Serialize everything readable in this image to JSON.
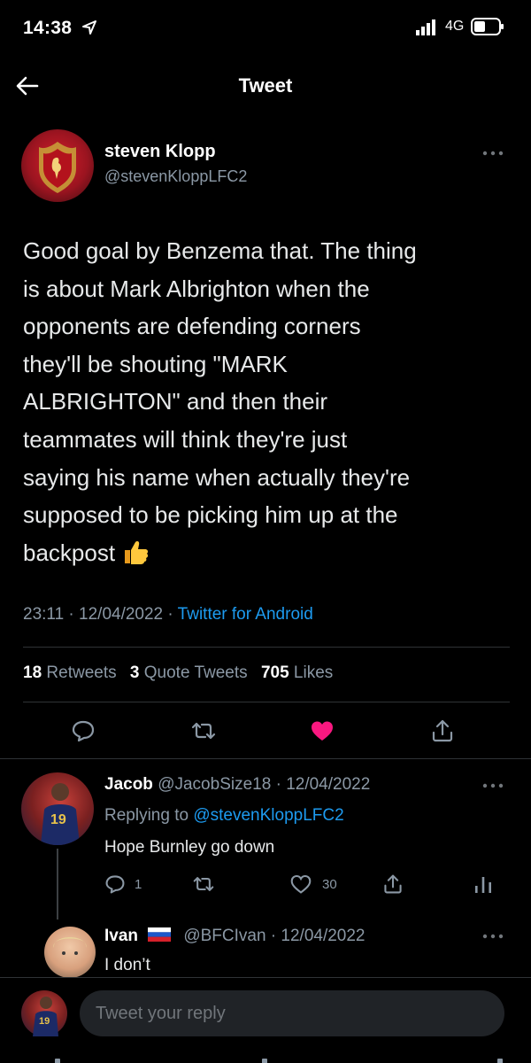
{
  "status_bar": {
    "time": "14:38",
    "network": "4G"
  },
  "header": {
    "title": "Tweet"
  },
  "tweet": {
    "author_name": "steven Klopp",
    "author_handle": "@stevenKloppLFC2",
    "text": "Good goal by Benzema that. The thing\nis about Mark Albrighton when the\nopponents are defending corners\nthey'll be shouting \"MARK\nALBRIGHTON\" and then their\nteammates will think they're just\nsaying his name when actually they're\nsupposed to be picking him up at the\nbackpost",
    "time": "23:11",
    "date": "12/04/2022",
    "source": "Twitter for Android",
    "retweets_count": "18",
    "retweets_label": "Retweets",
    "quote_count": "3",
    "quote_label": "Quote Tweets",
    "likes_count": "705",
    "likes_label": "Likes"
  },
  "replies": [
    {
      "name": "Jacob",
      "handle": "@JacobSize18",
      "date": "12/04/2022",
      "replying_label": "Replying to",
      "replying_to": "@stevenKloppLFC2",
      "text": "Hope Burnley go down",
      "reply_count": "1",
      "like_count": "30"
    },
    {
      "name": "Ivan",
      "handle": "@BFCIvan",
      "date": "12/04/2022",
      "text": "I don’t"
    }
  ],
  "composer": {
    "placeholder": "Tweet your reply"
  },
  "colors": {
    "background": "#000000",
    "accent_blue": "#1d9bf0",
    "like_pink": "#f91880",
    "muted": "#8b98a5"
  },
  "icons": {
    "back": "arrow-left-icon",
    "more": "more-horizontal-icon",
    "reply": "reply-icon",
    "retweet": "retweet-icon",
    "like": "heart-icon",
    "share": "share-icon",
    "analytics": "analytics-icon"
  }
}
